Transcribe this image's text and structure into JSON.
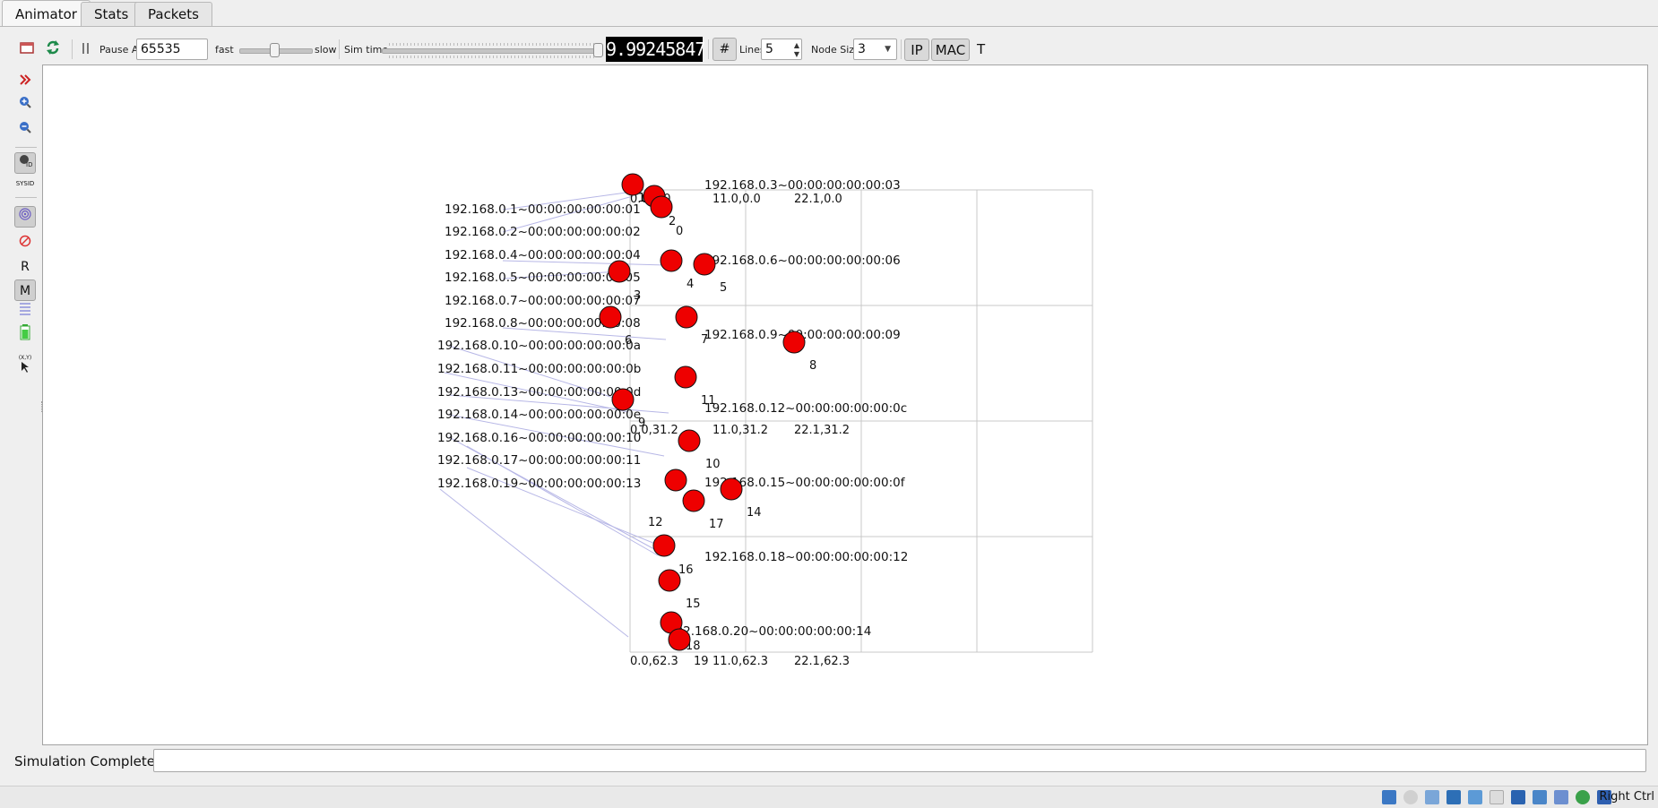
{
  "tabs": [
    {
      "label": "Animator",
      "active": true
    },
    {
      "label": "Stats",
      "active": false
    },
    {
      "label": "Packets",
      "active": false
    }
  ],
  "toolbar": {
    "pause_at_label": "Pause At",
    "pause_at_value": "65535",
    "fast_label": "fast",
    "slow_label": "slow",
    "speed_slider_level": 0.48,
    "sim_time_label": "Sim time",
    "sim_time_slider_level": 1.0,
    "sim_time_value": "9.99245847",
    "grid_button": "#",
    "lines_label": "Lines",
    "lines_value": "5",
    "node_size_label": "Node Size",
    "node_size_value": "3",
    "ip_button": "IP",
    "mac_button": "MAC",
    "t_button": "T"
  },
  "left_tools": {
    "r_label": "R",
    "m_label": "M",
    "sysid_label": "SYSID",
    "xy_label": "(X,Y)"
  },
  "canvas": {
    "grid_labels": [
      "0.0,0.0",
      "11.0,0.0",
      "22.1,0.0",
      "0.0,31.2",
      "11.0,31.2",
      "22.1,31.2",
      "0.0,62.3",
      "11.0,62.3",
      "22.1,62.3"
    ],
    "left_addresses": [
      "192.168.0.1~00:00:00:00:00:01",
      "192.168.0.2~00:00:00:00:00:02",
      "192.168.0.4~00:00:00:00:00:04",
      "192.168.0.5~00:00:00:00:00:05",
      "192.168.0.7~00:00:00:00:00:07",
      "192.168.0.8~00:00:00:00:00:08",
      "192.168.0.10~00:00:00:00:00:0a",
      "192.168.0.11~00:00:00:00:00:0b",
      "192.168.0.13~00:00:00:00:00:0d",
      "192.168.0.14~00:00:00:00:00:0e",
      "192.168.0.16~00:00:00:00:00:10",
      "192.168.0.17~00:00:00:00:00:11",
      "192.168.0.19~00:00:00:00:00:13"
    ],
    "right_addresses": [
      "192.168.0.3~00:00:00:00:00:03",
      "192.168.0.6~00:00:00:00:00:06",
      "192.168.0.9~00:00:00:00:00:09",
      "192.168.0.12~00:00:00:00:00:0c",
      "192.168.0.15~00:00:00:00:00:0f",
      "192.168.0.18~00:00:00:00:00:12",
      "192.168.0.20~00:00:00:00:00:14"
    ],
    "node_ids": [
      "0",
      "1",
      "2",
      "3",
      "4",
      "5",
      "6",
      "7",
      "8",
      "9",
      "10",
      "11",
      "12",
      "14",
      "15",
      "16",
      "17",
      "18",
      "19"
    ],
    "node_color": "#ee0000"
  },
  "status": {
    "text": "Simulation Completed",
    "message": ""
  },
  "taskbar": {
    "host_key": "Right Ctrl"
  }
}
